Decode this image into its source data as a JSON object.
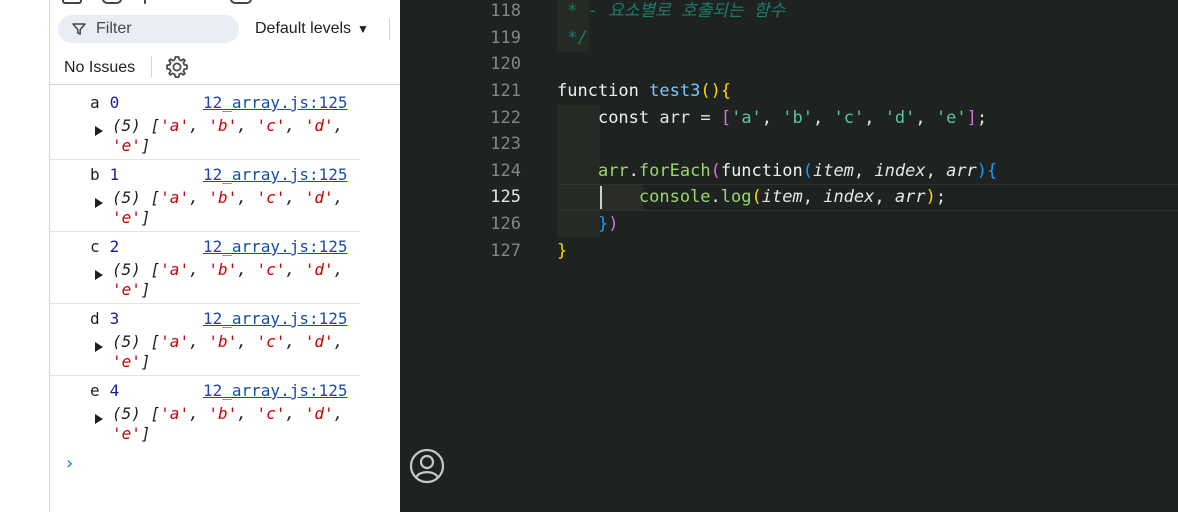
{
  "console": {
    "filter_placeholder": "Filter",
    "levels_label": "Default levels",
    "issues_label": "No Issues",
    "entries": [
      {
        "letter": "a",
        "index": "0",
        "source": "12_array.js:125"
      },
      {
        "letter": "b",
        "index": "1",
        "source": "12_array.js:125"
      },
      {
        "letter": "c",
        "index": "2",
        "source": "12_array.js:125"
      },
      {
        "letter": "d",
        "index": "3",
        "source": "12_array.js:125"
      },
      {
        "letter": "e",
        "index": "4",
        "source": "12_array.js:125"
      }
    ],
    "array_preview": {
      "count": "(5)",
      "items": [
        "'a'",
        "'b'",
        "'c'",
        "'d'",
        "'e'"
      ]
    },
    "prompt_symbol": "›"
  },
  "editor": {
    "active_line": "125",
    "line_numbers": [
      "118",
      "119",
      "120",
      "121",
      "122",
      "123",
      "124",
      "125",
      "126",
      "127"
    ],
    "lines": {
      "l118": " * - 요소별로 호출되는 함수",
      "l119": " */",
      "l121_kw": "function",
      "l121_name": "test3",
      "l122_kw": "const",
      "l122_var": "arr",
      "l122_vals": [
        "'a'",
        "'b'",
        "'c'",
        "'d'",
        "'e'"
      ],
      "l124_obj": "arr",
      "l124_method": "forEach",
      "l124_kw": "function",
      "l124_params": [
        "item",
        "index",
        "arr"
      ],
      "l125_obj": "console",
      "l125_method": "log",
      "l125_args": [
        "item",
        "index",
        "arr"
      ]
    }
  },
  "icons": {
    "filter": "filter-icon",
    "gear": "gear-icon",
    "dropdown": "chevron-down-icon",
    "expand": "expand-triangle-icon",
    "account": "account-icon"
  },
  "colors": {
    "console_link": "#1a4ea3",
    "string_red": "#c80000",
    "editor_bg": "#1e2221",
    "bracket_gold": "#ffd700",
    "bracket_purple": "#da70d6",
    "bracket_blue": "#179fff",
    "string_green": "#58c7a0"
  }
}
